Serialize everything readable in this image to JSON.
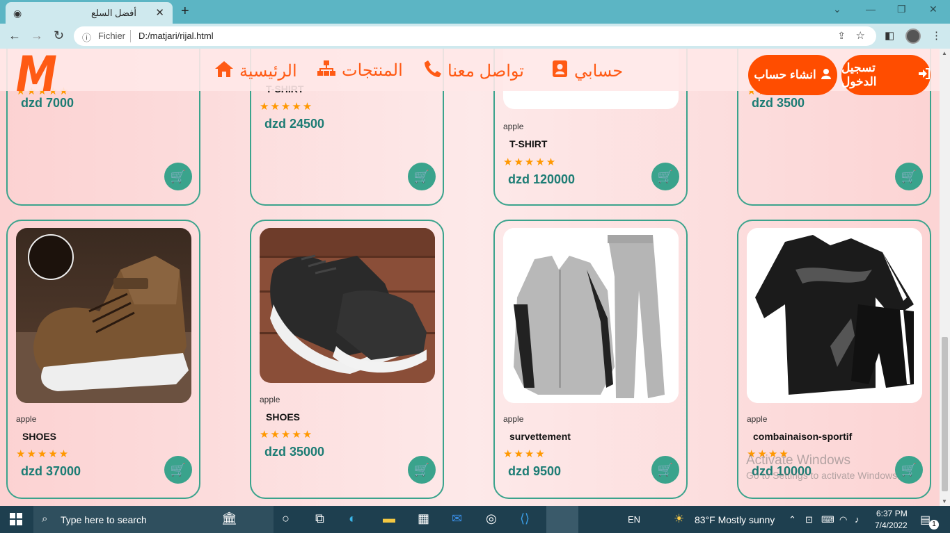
{
  "browser": {
    "tab_title": "أفضل السلع",
    "new_tab": "+",
    "close_tab": "✕",
    "minimize": "—",
    "restore": "❐",
    "close_window": "✕",
    "tab_list": "⌄",
    "url_scheme_label": "Fichier",
    "url": "D:/matjari/rijal.html"
  },
  "header": {
    "logo": "M",
    "nav": [
      {
        "label": "الرئيسية",
        "icon": "home-icon"
      },
      {
        "label": "المنتجات",
        "icon": "sitemap-icon"
      },
      {
        "label": "تواصل معنا",
        "icon": "phone-icon"
      },
      {
        "label": "حسابي",
        "icon": "contact-card-icon"
      }
    ],
    "signup_label": "انشاء حساب",
    "login_label": "تسجيل الدخول"
  },
  "products_top": [
    {
      "name": "",
      "brand": "",
      "price": "dzd 7000",
      "stars": 5
    },
    {
      "name": "T-SHIRT",
      "brand": "",
      "price": "dzd 24500",
      "stars": 5
    },
    {
      "name": "T-SHIRT",
      "brand": "apple",
      "price": "dzd 120000",
      "stars": 5
    },
    {
      "name": "",
      "brand": "",
      "price": "dzd 3500",
      "stars": 5
    }
  ],
  "products_bottom": [
    {
      "name": "SHOES",
      "brand": "apple",
      "price": "dzd 37000",
      "stars": 5
    },
    {
      "name": "SHOES",
      "brand": "apple",
      "price": "dzd 35000",
      "stars": 5
    },
    {
      "name": "survettement",
      "brand": "apple",
      "price": "dzd 9500",
      "stars": 4
    },
    {
      "name": "combainaison-sportif",
      "brand": "apple",
      "price": "dzd 10000",
      "stars": 4
    }
  ],
  "watermark": {
    "line1": "Activate Windows",
    "line2": "Go to Settings to activate Windows."
  },
  "taskbar": {
    "search_placeholder": "Type here to search",
    "language": "EN",
    "weather": "83°F  Mostly sunny",
    "time": "6:37 PM",
    "date": "7/4/2022",
    "notifications": "1"
  },
  "colors": {
    "accent_orange": "#ff5a14",
    "teal": "#3aa38c",
    "price_teal": "#1c7c74",
    "star": "#ff9800"
  }
}
